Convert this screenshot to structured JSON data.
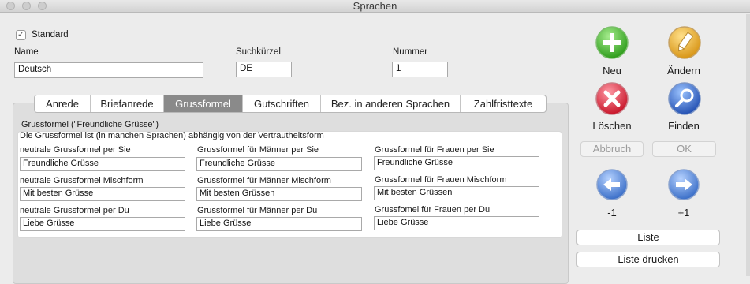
{
  "window": {
    "title": "Sprachen"
  },
  "header": {
    "standard_label": "Standard",
    "name_label": "Name",
    "name_value": "Deutsch",
    "short_label": "Suchkürzel",
    "short_value": "DE",
    "number_label": "Nummer",
    "number_value": "1"
  },
  "tabs": [
    "Anrede",
    "Briefanrede",
    "Grussformel",
    "Gutschriften",
    "Bez. in anderen Sprachen",
    "Zahlfristtexte"
  ],
  "panel": {
    "title": "Grussformel (\"Freundliche Grüsse\")",
    "note": "Die Grussformel ist (in manchen Sprachen) abhängig von der Vertrautheitsform",
    "fields": [
      {
        "label": "neutrale Grussformel per Sie",
        "value": "Freundliche Grüsse"
      },
      {
        "label": "Grussformel für Männer per Sie",
        "value": "Freundliche Grüsse"
      },
      {
        "label": "Grussformel für Frauen per Sie",
        "value": "Freundliche Grüsse"
      },
      {
        "label": "neutrale Grussformel Mischform",
        "value": "Mit besten Grüsse"
      },
      {
        "label": "Grussformel für Männer Mischform",
        "value": "Mit besten Grüssen"
      },
      {
        "label": "Grussformel für Frauen Mischform",
        "value": "Mit besten Grüssen"
      },
      {
        "label": "neutrale Grussformel per Du",
        "value": "Liebe Grüsse"
      },
      {
        "label": "Grussformel für Männer per Du",
        "value": "Liebe Grüsse"
      },
      {
        "label": "Grussfomel für Frauen per Du",
        "value": "Liebe Grüsse"
      }
    ]
  },
  "actions": {
    "new": "Neu",
    "edit": "Ändern",
    "delete": "Löschen",
    "find": "Finden",
    "cancel": "Abbruch",
    "ok": "OK",
    "prev": "-1",
    "next": "+1",
    "list": "Liste",
    "print_list": "Liste drucken"
  },
  "colors": {
    "new": "#3fae2a",
    "delete": "#d8283a",
    "edit": "#e0a62a",
    "find": "#2c5fbf",
    "nav": "#4a7fd0"
  }
}
